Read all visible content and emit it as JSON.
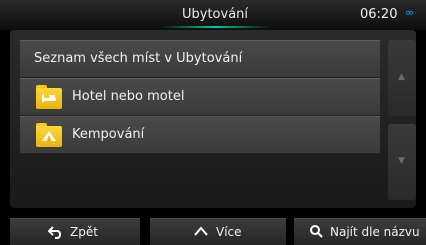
{
  "header": {
    "title": "Ubytování",
    "time": "06:20",
    "time_suffix": "∞"
  },
  "list": {
    "items": [
      {
        "label": "Seznam všech míst v Ubytování"
      },
      {
        "label": "Hotel nebo motel",
        "icon": "bed-icon"
      },
      {
        "label": "Kempování",
        "icon": "tent-icon"
      }
    ]
  },
  "footer": {
    "back_label": "Zpět",
    "more_label": "Více",
    "search_label": "Najít dle názvu"
  },
  "colors": {
    "accent": "#00c9a0",
    "folder": "#f4c81a",
    "infinity": "#1aa6e6"
  }
}
